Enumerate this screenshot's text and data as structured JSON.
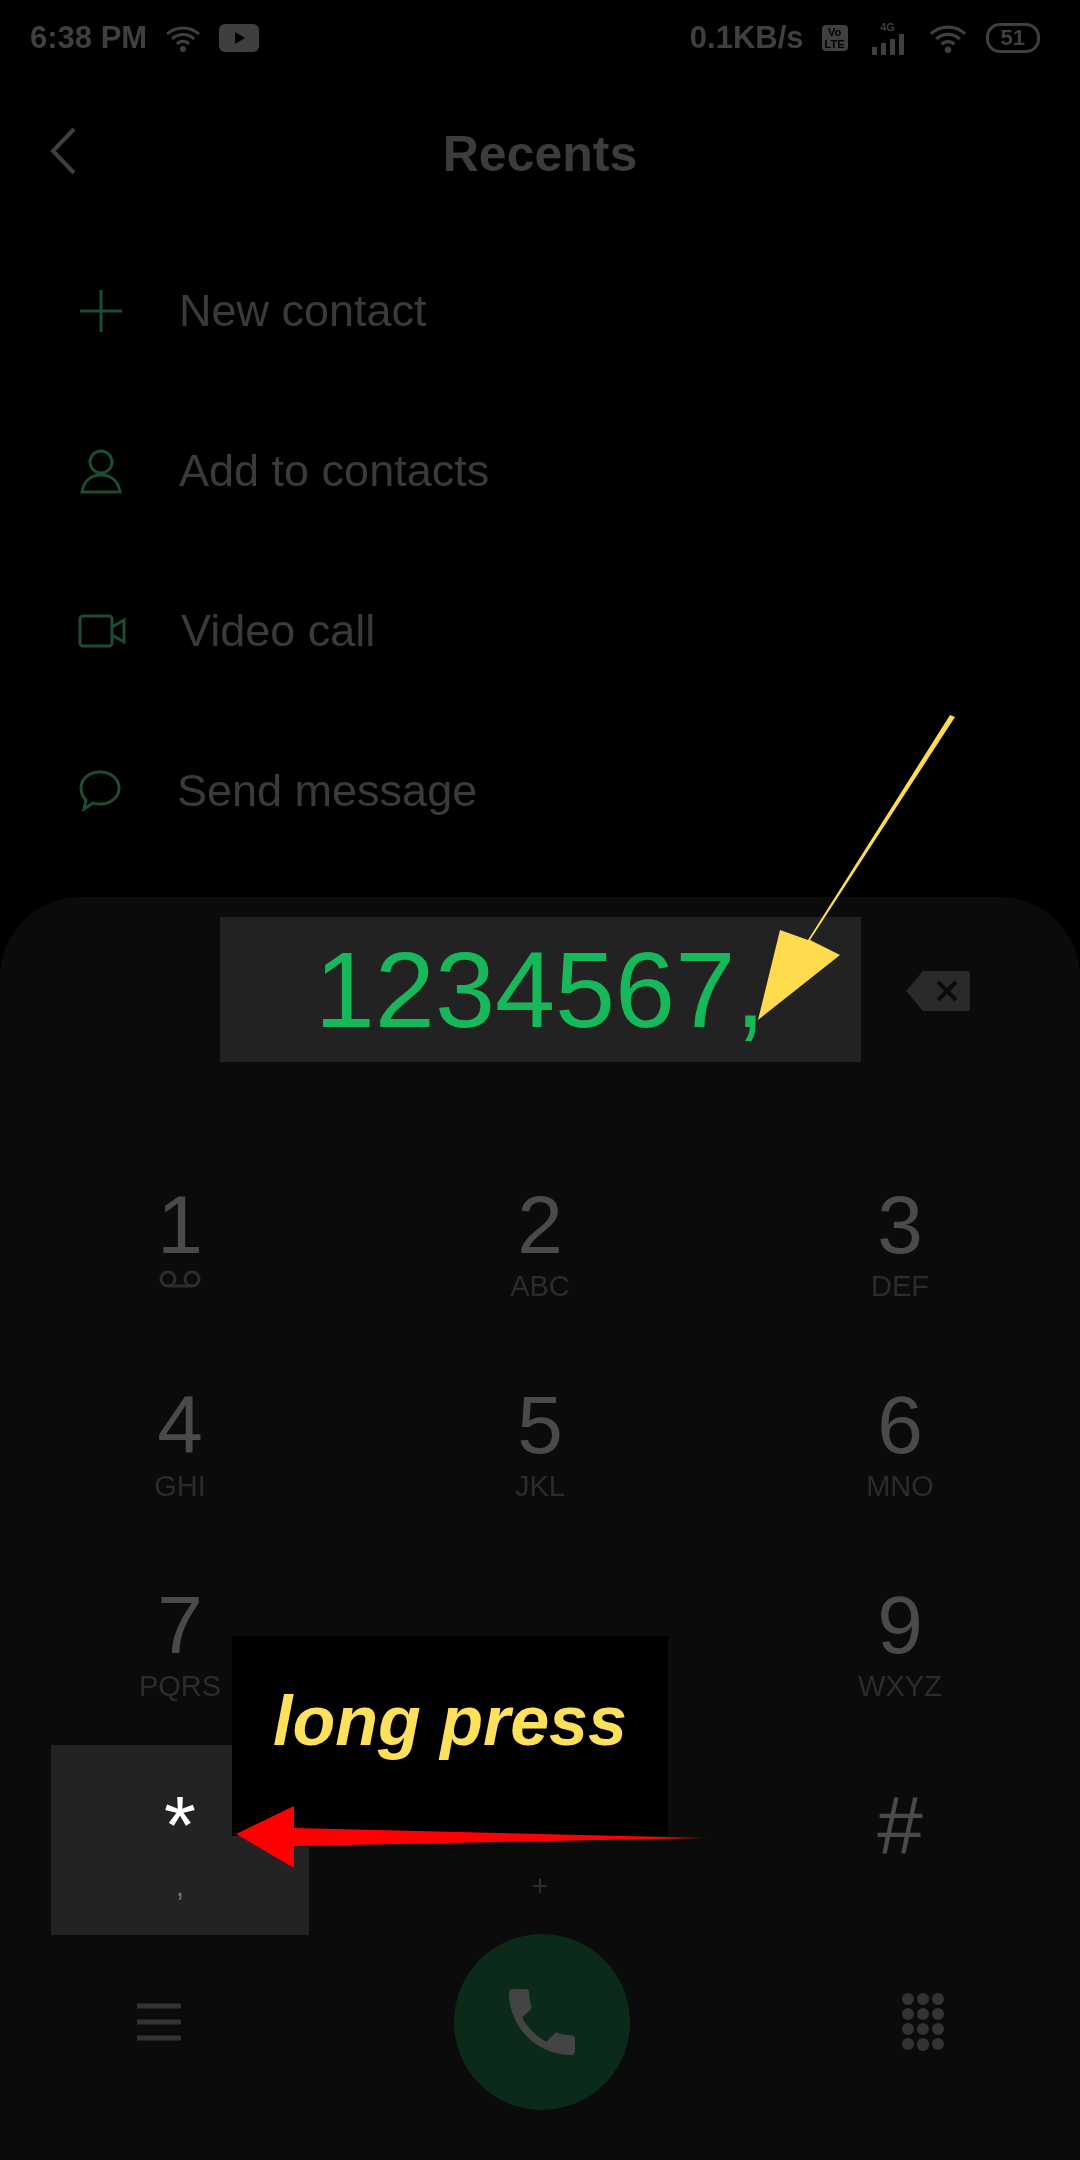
{
  "status_bar": {
    "time": "6:38 PM",
    "speed": "0.1KB/s",
    "volte_top": "Vo",
    "volte_bottom": "LTE",
    "network": "4G",
    "battery": "51"
  },
  "header": {
    "title": "Recents"
  },
  "actions": [
    {
      "kind": "add",
      "label": "New contact"
    },
    {
      "kind": "person",
      "label": "Add to contacts"
    },
    {
      "kind": "video",
      "label": "Video call"
    },
    {
      "kind": "message",
      "label": "Send message"
    }
  ],
  "dialer": {
    "number": "1234567,",
    "keys": [
      {
        "digit": "1",
        "kind": "voicemail",
        "pressed": false
      },
      {
        "digit": "2",
        "sub": "ABC",
        "kind": "letters",
        "pressed": false
      },
      {
        "digit": "3",
        "sub": "DEF",
        "kind": "letters",
        "pressed": false
      },
      {
        "digit": "4",
        "sub": "GHI",
        "kind": "letters",
        "pressed": false
      },
      {
        "digit": "5",
        "sub": "JKL",
        "kind": "letters",
        "pressed": false
      },
      {
        "digit": "6",
        "sub": "MNO",
        "kind": "letters",
        "pressed": false
      },
      {
        "digit": "7",
        "sub": "PQRS",
        "kind": "letters",
        "pressed": false
      },
      {
        "kind": "letters",
        "pressed": false
      },
      {
        "digit": "9",
        "sub": "WXYZ",
        "kind": "letters",
        "pressed": false
      },
      {
        "digit": "*",
        "sub": ",",
        "kind": "letters",
        "pressed": true
      },
      {
        "digit": "#",
        "kind": "letters",
        "pressed": false
      }
    ],
    "zero_key": {
      "sub": "+"
    }
  },
  "annotation": {
    "label": "long press"
  }
}
